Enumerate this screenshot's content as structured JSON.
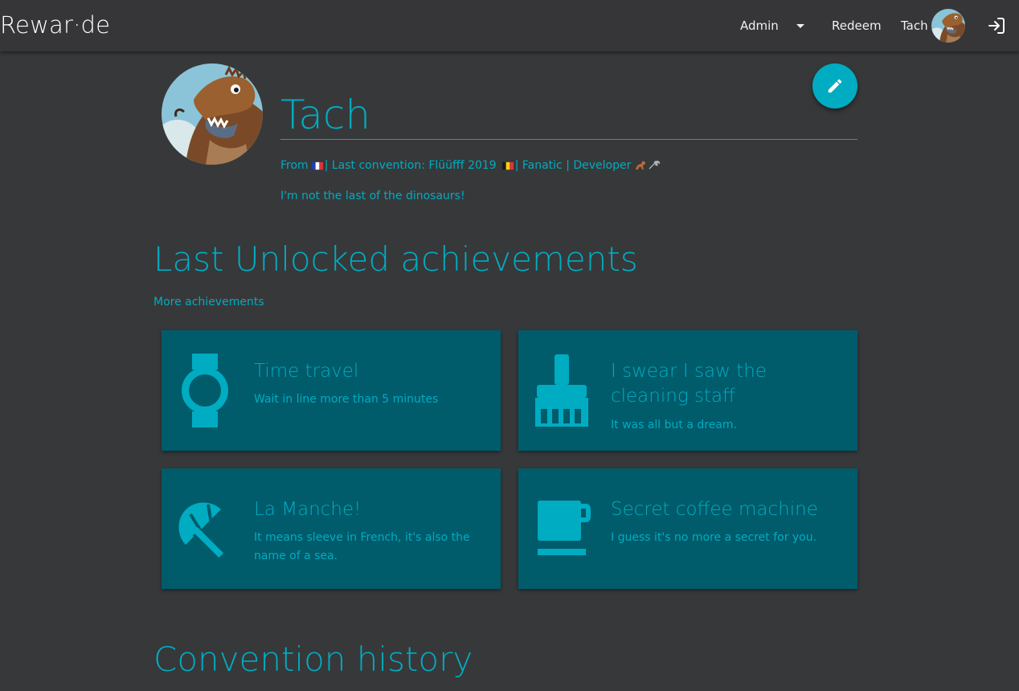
{
  "header": {
    "brand": "Rewar·de",
    "nav_admin": "Admin",
    "nav_redeem": "Redeem",
    "nav_user": "Tach"
  },
  "profile": {
    "name": "Tach",
    "line_from": "From",
    "line_convention": "| Last convention: Flüüfff 2019",
    "line_rest": "| Fanatic | Developer",
    "bio": "I'm not the last of the dinosaurs!"
  },
  "achievements": {
    "title": "Last Unlocked achievements",
    "more_link": "More achievements",
    "cards": [
      {
        "title": "Time travel",
        "description": "Wait in line more than 5 minutes",
        "icon": "watch-icon"
      },
      {
        "title": "I swear I saw the cleaning staff",
        "description": "It was all but a dream.",
        "icon": "broom-icon"
      },
      {
        "title": "La Manche!",
        "description": "It means sleeve in French, it's also the name of a sea.",
        "icon": "beach-umbrella-icon"
      },
      {
        "title": "Secret coffee machine",
        "description": "I guess it's no more a secret for you.",
        "icon": "coffee-cup-icon"
      }
    ]
  },
  "history": {
    "title": "Convention history"
  },
  "colors": {
    "background": "#37383a",
    "topbar": "#363638",
    "accent": "#00acc1",
    "card": "#005b6b"
  }
}
